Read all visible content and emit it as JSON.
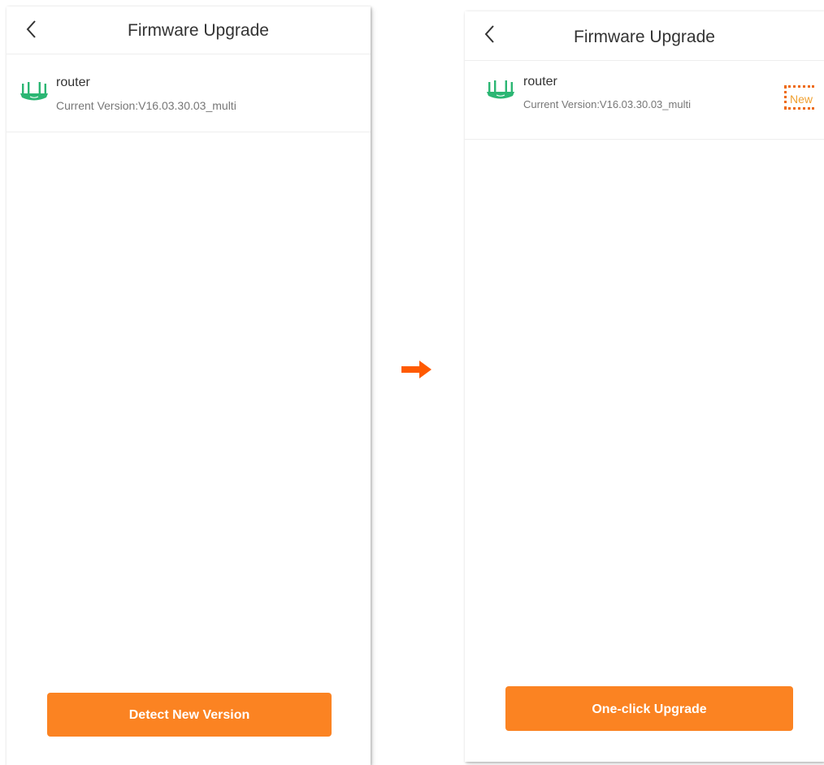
{
  "colors": {
    "accent": "#fb8322",
    "router_icon": "#2bb673",
    "badge_border": "#ee6a10",
    "badge_text": "#f0a030",
    "arrow": "#ff5a00"
  },
  "icons": {
    "back": "chevron-left-icon",
    "device": "router-icon",
    "flow": "right-arrow-icon"
  },
  "before_screen": {
    "title": "Firmware Upgrade",
    "device": {
      "name": "router",
      "version": "Current Version:V16.03.30.03_multi"
    },
    "button_label": "Detect New Version"
  },
  "after_screen": {
    "title": "Firmware Upgrade",
    "device": {
      "name": "router",
      "version": "Current Version:V16.03.30.03_multi",
      "badge": "New"
    },
    "button_label": "One-click Upgrade"
  }
}
